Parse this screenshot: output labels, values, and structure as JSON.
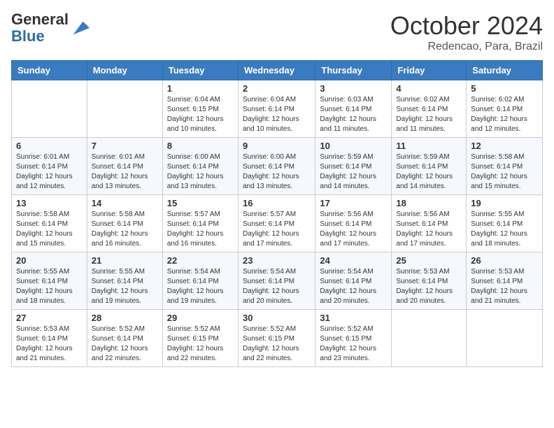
{
  "header": {
    "logo_general": "General",
    "logo_blue": "Blue",
    "month_title": "October 2024",
    "location": "Redencao, Para, Brazil"
  },
  "days_of_week": [
    "Sunday",
    "Monday",
    "Tuesday",
    "Wednesday",
    "Thursday",
    "Friday",
    "Saturday"
  ],
  "weeks": [
    [
      {
        "day": "",
        "sunrise": "",
        "sunset": "",
        "daylight": ""
      },
      {
        "day": "",
        "sunrise": "",
        "sunset": "",
        "daylight": ""
      },
      {
        "day": "1",
        "sunrise": "Sunrise: 6:04 AM",
        "sunset": "Sunset: 6:15 PM",
        "daylight": "Daylight: 12 hours and 10 minutes."
      },
      {
        "day": "2",
        "sunrise": "Sunrise: 6:04 AM",
        "sunset": "Sunset: 6:14 PM",
        "daylight": "Daylight: 12 hours and 10 minutes."
      },
      {
        "day": "3",
        "sunrise": "Sunrise: 6:03 AM",
        "sunset": "Sunset: 6:14 PM",
        "daylight": "Daylight: 12 hours and 11 minutes."
      },
      {
        "day": "4",
        "sunrise": "Sunrise: 6:02 AM",
        "sunset": "Sunset: 6:14 PM",
        "daylight": "Daylight: 12 hours and 11 minutes."
      },
      {
        "day": "5",
        "sunrise": "Sunrise: 6:02 AM",
        "sunset": "Sunset: 6:14 PM",
        "daylight": "Daylight: 12 hours and 12 minutes."
      }
    ],
    [
      {
        "day": "6",
        "sunrise": "Sunrise: 6:01 AM",
        "sunset": "Sunset: 6:14 PM",
        "daylight": "Daylight: 12 hours and 12 minutes."
      },
      {
        "day": "7",
        "sunrise": "Sunrise: 6:01 AM",
        "sunset": "Sunset: 6:14 PM",
        "daylight": "Daylight: 12 hours and 13 minutes."
      },
      {
        "day": "8",
        "sunrise": "Sunrise: 6:00 AM",
        "sunset": "Sunset: 6:14 PM",
        "daylight": "Daylight: 12 hours and 13 minutes."
      },
      {
        "day": "9",
        "sunrise": "Sunrise: 6:00 AM",
        "sunset": "Sunset: 6:14 PM",
        "daylight": "Daylight: 12 hours and 13 minutes."
      },
      {
        "day": "10",
        "sunrise": "Sunrise: 5:59 AM",
        "sunset": "Sunset: 6:14 PM",
        "daylight": "Daylight: 12 hours and 14 minutes."
      },
      {
        "day": "11",
        "sunrise": "Sunrise: 5:59 AM",
        "sunset": "Sunset: 6:14 PM",
        "daylight": "Daylight: 12 hours and 14 minutes."
      },
      {
        "day": "12",
        "sunrise": "Sunrise: 5:58 AM",
        "sunset": "Sunset: 6:14 PM",
        "daylight": "Daylight: 12 hours and 15 minutes."
      }
    ],
    [
      {
        "day": "13",
        "sunrise": "Sunrise: 5:58 AM",
        "sunset": "Sunset: 6:14 PM",
        "daylight": "Daylight: 12 hours and 15 minutes."
      },
      {
        "day": "14",
        "sunrise": "Sunrise: 5:58 AM",
        "sunset": "Sunset: 6:14 PM",
        "daylight": "Daylight: 12 hours and 16 minutes."
      },
      {
        "day": "15",
        "sunrise": "Sunrise: 5:57 AM",
        "sunset": "Sunset: 6:14 PM",
        "daylight": "Daylight: 12 hours and 16 minutes."
      },
      {
        "day": "16",
        "sunrise": "Sunrise: 5:57 AM",
        "sunset": "Sunset: 6:14 PM",
        "daylight": "Daylight: 12 hours and 17 minutes."
      },
      {
        "day": "17",
        "sunrise": "Sunrise: 5:56 AM",
        "sunset": "Sunset: 6:14 PM",
        "daylight": "Daylight: 12 hours and 17 minutes."
      },
      {
        "day": "18",
        "sunrise": "Sunrise: 5:56 AM",
        "sunset": "Sunset: 6:14 PM",
        "daylight": "Daylight: 12 hours and 17 minutes."
      },
      {
        "day": "19",
        "sunrise": "Sunrise: 5:55 AM",
        "sunset": "Sunset: 6:14 PM",
        "daylight": "Daylight: 12 hours and 18 minutes."
      }
    ],
    [
      {
        "day": "20",
        "sunrise": "Sunrise: 5:55 AM",
        "sunset": "Sunset: 6:14 PM",
        "daylight": "Daylight: 12 hours and 18 minutes."
      },
      {
        "day": "21",
        "sunrise": "Sunrise: 5:55 AM",
        "sunset": "Sunset: 6:14 PM",
        "daylight": "Daylight: 12 hours and 19 minutes."
      },
      {
        "day": "22",
        "sunrise": "Sunrise: 5:54 AM",
        "sunset": "Sunset: 6:14 PM",
        "daylight": "Daylight: 12 hours and 19 minutes."
      },
      {
        "day": "23",
        "sunrise": "Sunrise: 5:54 AM",
        "sunset": "Sunset: 6:14 PM",
        "daylight": "Daylight: 12 hours and 20 minutes."
      },
      {
        "day": "24",
        "sunrise": "Sunrise: 5:54 AM",
        "sunset": "Sunset: 6:14 PM",
        "daylight": "Daylight: 12 hours and 20 minutes."
      },
      {
        "day": "25",
        "sunrise": "Sunrise: 5:53 AM",
        "sunset": "Sunset: 6:14 PM",
        "daylight": "Daylight: 12 hours and 20 minutes."
      },
      {
        "day": "26",
        "sunrise": "Sunrise: 5:53 AM",
        "sunset": "Sunset: 6:14 PM",
        "daylight": "Daylight: 12 hours and 21 minutes."
      }
    ],
    [
      {
        "day": "27",
        "sunrise": "Sunrise: 5:53 AM",
        "sunset": "Sunset: 6:14 PM",
        "daylight": "Daylight: 12 hours and 21 minutes."
      },
      {
        "day": "28",
        "sunrise": "Sunrise: 5:52 AM",
        "sunset": "Sunset: 6:14 PM",
        "daylight": "Daylight: 12 hours and 22 minutes."
      },
      {
        "day": "29",
        "sunrise": "Sunrise: 5:52 AM",
        "sunset": "Sunset: 6:15 PM",
        "daylight": "Daylight: 12 hours and 22 minutes."
      },
      {
        "day": "30",
        "sunrise": "Sunrise: 5:52 AM",
        "sunset": "Sunset: 6:15 PM",
        "daylight": "Daylight: 12 hours and 22 minutes."
      },
      {
        "day": "31",
        "sunrise": "Sunrise: 5:52 AM",
        "sunset": "Sunset: 6:15 PM",
        "daylight": "Daylight: 12 hours and 23 minutes."
      },
      {
        "day": "",
        "sunrise": "",
        "sunset": "",
        "daylight": ""
      },
      {
        "day": "",
        "sunrise": "",
        "sunset": "",
        "daylight": ""
      }
    ]
  ]
}
